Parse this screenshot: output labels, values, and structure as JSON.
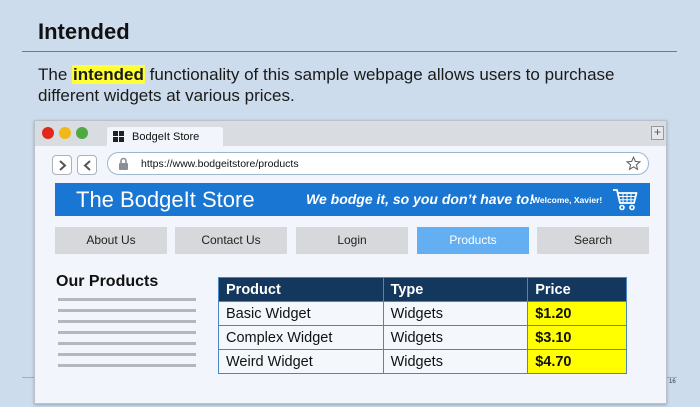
{
  "slide": {
    "title": "Intended",
    "text_before": "The ",
    "highlight": "intended",
    "text_after": " functionality of this sample webpage allows users to purchase different widgets at various prices.",
    "page_number": "16"
  },
  "browser": {
    "tab_label": "BodgeIt Store",
    "new_tab": "+",
    "url": "https://www.bodgeitstore/products",
    "icons": [
      "chevron-right-icon",
      "chevron-left-icon",
      "lock-icon",
      "star-icon"
    ]
  },
  "site": {
    "store_name": "The BodgeIt Store",
    "tagline": "We bodge it, so you don’t have to!",
    "welcome": "Welcome, Xavier!",
    "brand_color": "#1976d2",
    "nav": [
      {
        "label": "About Us"
      },
      {
        "label": "Contact Us"
      },
      {
        "label": "Login"
      },
      {
        "label": "Products",
        "active": true
      },
      {
        "label": "Search"
      }
    ],
    "products_heading": "Our Products",
    "table": {
      "headers": [
        "Product",
        "Type",
        "Price"
      ],
      "rows": [
        [
          "Basic Widget",
          "Widgets",
          "$1.20"
        ],
        [
          "Complex Widget",
          "Widgets",
          "$3.10"
        ],
        [
          "Weird Widget",
          "Widgets",
          "$4.70"
        ]
      ]
    }
  }
}
